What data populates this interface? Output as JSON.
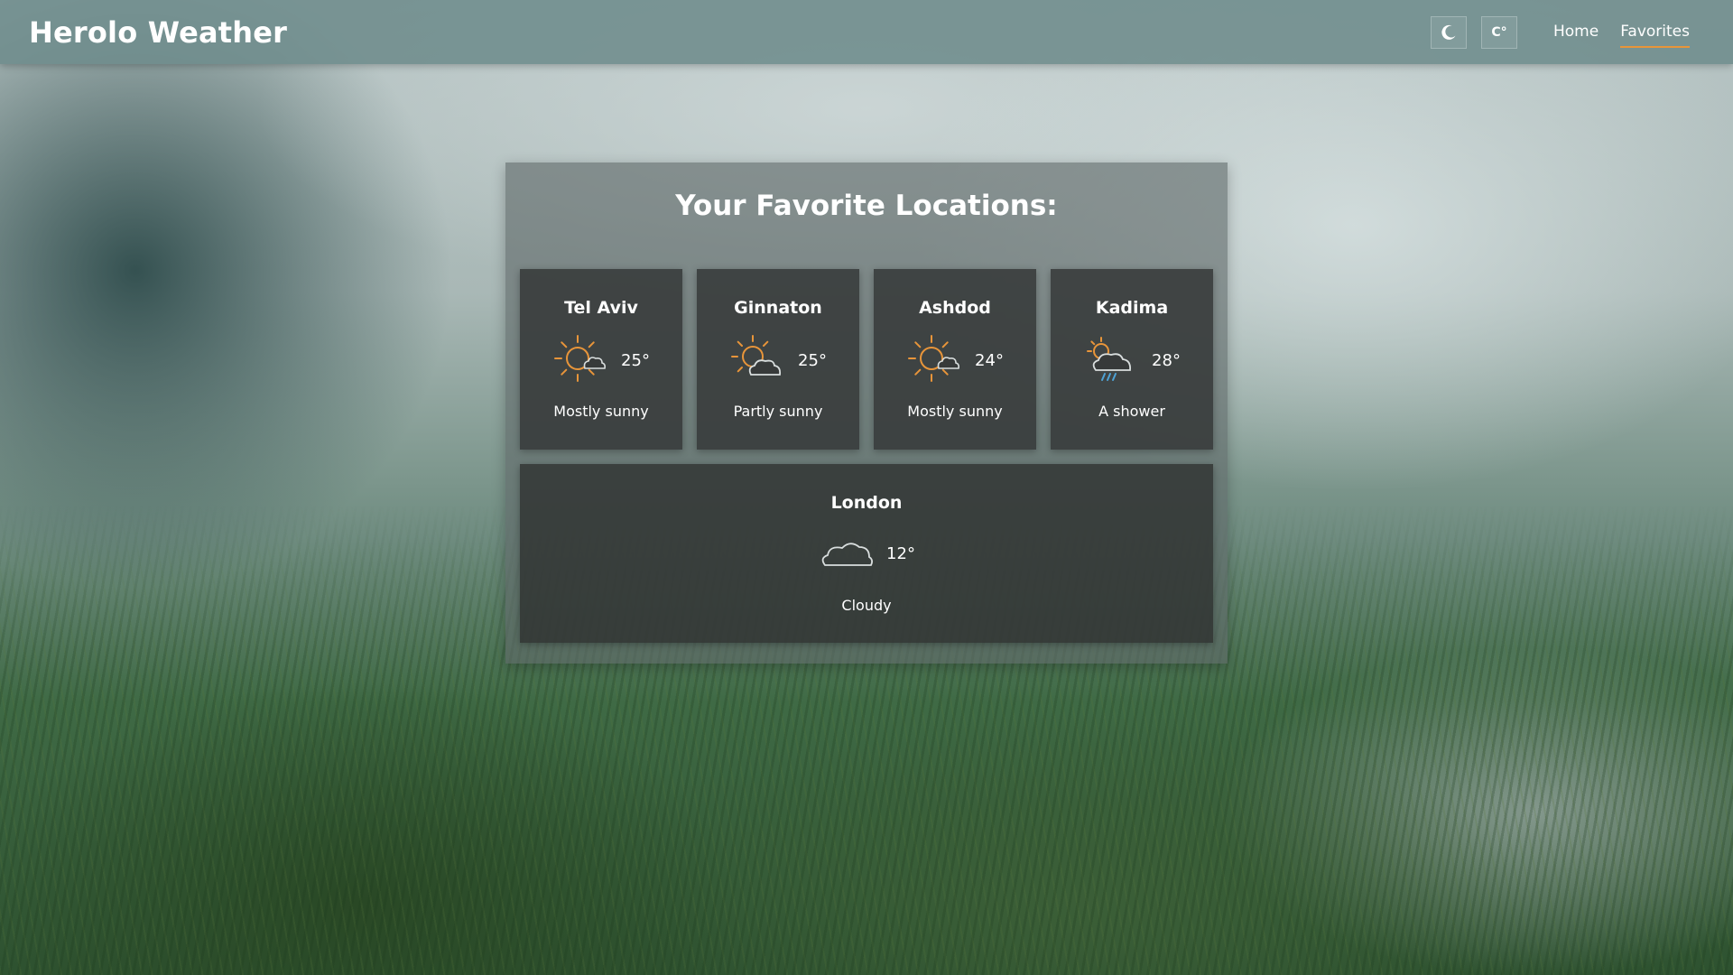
{
  "app": {
    "title": "Herolo Weather"
  },
  "header": {
    "theme_toggle_icon": "moon-icon",
    "unit_toggle_label": "C°",
    "nav": [
      {
        "label": "Home",
        "active": false
      },
      {
        "label": "Favorites",
        "active": true
      }
    ],
    "accent_color": "#e8953a"
  },
  "favorites": {
    "heading": "Your Favorite Locations:",
    "locations": [
      {
        "city": "Tel Aviv",
        "temperature": "25°",
        "condition": "Mostly sunny",
        "icon": "mostly-sunny-icon"
      },
      {
        "city": "Ginnaton",
        "temperature": "25°",
        "condition": "Partly sunny",
        "icon": "partly-sunny-icon"
      },
      {
        "city": "Ashdod",
        "temperature": "24°",
        "condition": "Mostly sunny",
        "icon": "mostly-sunny-icon"
      },
      {
        "city": "Kadima",
        "temperature": "28°",
        "condition": "A shower",
        "icon": "shower-icon"
      },
      {
        "city": "London",
        "temperature": "12°",
        "condition": "Cloudy",
        "icon": "cloudy-icon"
      }
    ]
  }
}
